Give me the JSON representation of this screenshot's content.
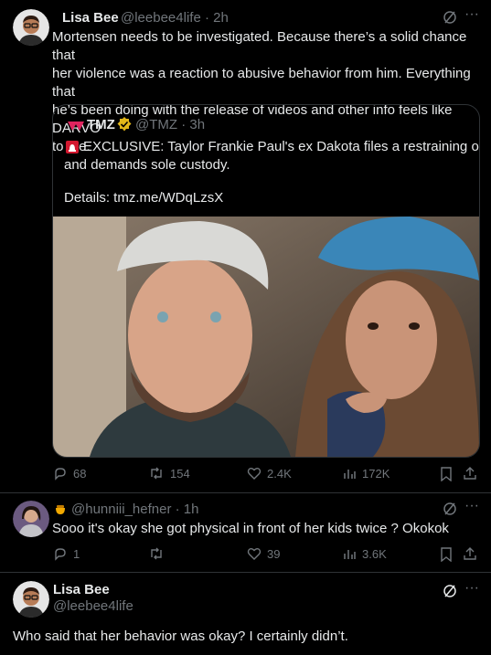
{
  "post1": {
    "name": "Lisa Bee",
    "meta": "@leebee4life · 2h",
    "text_lines": [
      "Mortensen needs to be investigated. Because there’s a solid chance that",
      "her violence was a reaction to abusive behavior from him. Everything that",
      "he’s been doing with the release of videos and other info feels like DARVO",
      "to me."
    ],
    "quote": {
      "name": "TMZ",
      "meta": "@TMZ · 3h",
      "line1": "EXCLUSIVE: Taylor Frankie Paul's ex Dakota files a restraining order,",
      "line2": "and demands sole custody.",
      "details": "Details: tmz.me/WDqLzsX"
    },
    "actions": {
      "replies": "68",
      "reposts": "154",
      "likes": "2.4K",
      "views": "172K"
    }
  },
  "post2": {
    "meta": "@hunniii_hefner · 1h",
    "text": "Sooo it's okay she got physical in front of her kids twice ? Okokok",
    "actions": {
      "replies": "1",
      "reposts": "",
      "likes": "39",
      "views": "3.6K"
    }
  },
  "post3": {
    "name": "Lisa Bee",
    "handle": "@leebee4life",
    "text": "Who said that her behavior was okay? I certainly didn’t."
  },
  "colors": {
    "background": "#000000",
    "text": "#e7e9ea",
    "muted": "#71767b",
    "border": "#2f3336",
    "verified": "#e2b719",
    "tmz_red": "#e0245e"
  }
}
